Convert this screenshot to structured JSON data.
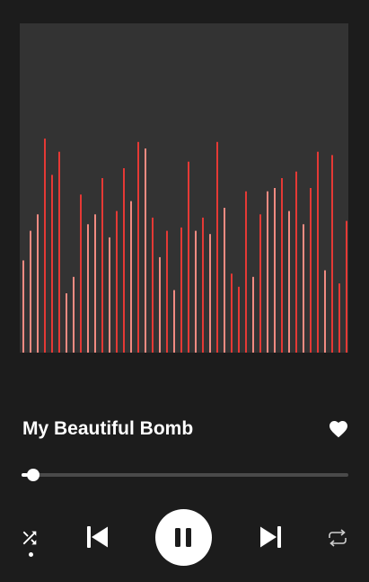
{
  "track": {
    "title": "My Beautiful Bomb",
    "liked": true,
    "progress_fraction": 0.02,
    "is_playing": true
  },
  "controls": {
    "shuffle_active": true,
    "icons": [
      "shuffle-icon",
      "previous-icon",
      "pause-icon",
      "next-icon",
      "repeat-icon",
      "heart-icon"
    ]
  },
  "colors": {
    "background": "#1c1c1c",
    "artwork_background": "#333333",
    "accent": "#ffffff",
    "bar_red": "#e53935",
    "bar_pink": "#f28b82"
  },
  "visualizer": {
    "levels": [
      0.28,
      0.37,
      0.42,
      0.65,
      0.54,
      0.61,
      0.18,
      0.23,
      0.48,
      0.39,
      0.42,
      0.53,
      0.35,
      0.43,
      0.56,
      0.46,
      0.64,
      0.62,
      0.41,
      0.29,
      0.37,
      0.19,
      0.38,
      0.58,
      0.37,
      0.41,
      0.36,
      0.64,
      0.44,
      0.24,
      0.2,
      0.49,
      0.23,
      0.42,
      0.49,
      0.5,
      0.53,
      0.43,
      0.55,
      0.39,
      0.5,
      0.61,
      0.25,
      0.6,
      0.21,
      0.4
    ],
    "shades": [
      "pink",
      "pink",
      "pink",
      "red",
      "red",
      "red",
      "pink",
      "pink",
      "red",
      "pink",
      "pink",
      "red",
      "pink",
      "red",
      "red",
      "pink",
      "red",
      "pink",
      "red",
      "pink",
      "red",
      "pink",
      "red",
      "red",
      "pink",
      "red",
      "pink",
      "red",
      "pink",
      "red",
      "red",
      "red",
      "pink",
      "red",
      "pink",
      "pink",
      "red",
      "pink",
      "red",
      "pink",
      "red",
      "red",
      "pink",
      "red",
      "red",
      "red"
    ]
  }
}
